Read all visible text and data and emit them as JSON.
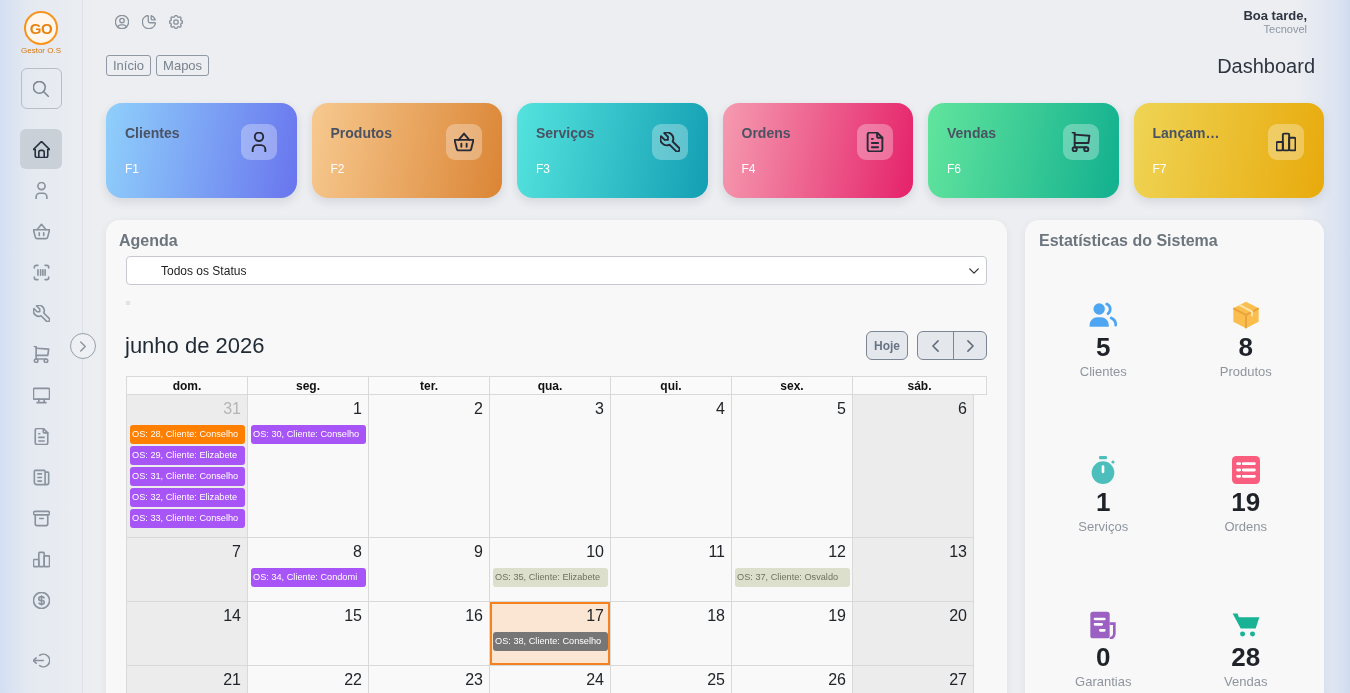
{
  "sidebar": {
    "logo": {
      "mark": "GO",
      "caption": "Gestor O.S"
    },
    "items": [
      {
        "selected": true
      },
      {
        "selected": false
      },
      {
        "selected": false
      },
      {
        "selected": false
      },
      {
        "selected": false
      },
      {
        "selected": false
      },
      {
        "selected": false
      },
      {
        "selected": false
      },
      {
        "selected": false
      },
      {
        "selected": false
      },
      {
        "selected": false
      },
      {
        "selected": false
      }
    ]
  },
  "top_bar": {
    "greeting": "Boa tarde,",
    "user": "Tecnovel"
  },
  "breadcrumbs": [
    "Início",
    "Mapos"
  ],
  "page_title": "Dashboard",
  "shortcuts": [
    {
      "label": "Clientes",
      "key": "F1"
    },
    {
      "label": "Produtos",
      "key": "F2"
    },
    {
      "label": "Serviços",
      "key": "F3"
    },
    {
      "label": "Ordens",
      "key": "F4"
    },
    {
      "label": "Vendas",
      "key": "F6"
    },
    {
      "label": "Lançam…",
      "key": "F7"
    }
  ],
  "agenda": {
    "title": "Agenda",
    "status_filter": {
      "value": "Todos os Status"
    },
    "month_title": "junho de 2026",
    "today_button": "Hoje",
    "weekdays": [
      "dom.",
      "seg.",
      "ter.",
      "qua.",
      "qui.",
      "sex.",
      "sáb."
    ],
    "weeks": [
      {
        "days": [
          {
            "day": "31",
            "outside": true,
            "today": false,
            "events": [
              {
                "text": "OS: 28, Cliente: Conselho",
                "color": "#ff7f00"
              },
              {
                "text": "OS: 29, Cliente: Elizabete",
                "color": "#a855f7"
              },
              {
                "text": "OS: 31, Cliente: Conselho",
                "color": "#a855f7"
              },
              {
                "text": "OS: 32, Cliente: Elizabete",
                "color": "#a855f7"
              },
              {
                "text": "OS: 33, Cliente: Conselho",
                "color": "#a855f7"
              }
            ]
          },
          {
            "day": "1",
            "outside": false,
            "today": false,
            "events": [
              {
                "text": "OS: 30, Cliente: Conselho",
                "color": "#a855f7"
              }
            ]
          },
          {
            "day": "2",
            "outside": false,
            "today": false
          },
          {
            "day": "3",
            "outside": false,
            "today": false
          },
          {
            "day": "4",
            "outside": false,
            "today": false
          },
          {
            "day": "5",
            "outside": false,
            "today": false
          },
          {
            "day": "6",
            "outside": false,
            "today": false
          }
        ]
      },
      {
        "days": [
          {
            "day": "7",
            "outside": false,
            "today": false
          },
          {
            "day": "8",
            "outside": false,
            "today": false,
            "events": [
              {
                "text": "OS: 34, Cliente: Condomi",
                "color": "#a855f7"
              }
            ]
          },
          {
            "day": "9",
            "outside": false,
            "today": false
          },
          {
            "day": "10",
            "outside": false,
            "today": false,
            "events": [
              {
                "text": "OS: 35, Cliente: Elizabete",
                "color": "#dcdfcb"
              }
            ]
          },
          {
            "day": "11",
            "outside": false,
            "today": false
          },
          {
            "day": "12",
            "outside": false,
            "today": false,
            "events": [
              {
                "text": "OS: 37, Cliente: Osvaldo",
                "color": "#dcdfcb"
              }
            ]
          },
          {
            "day": "13",
            "outside": false,
            "today": false
          }
        ]
      },
      {
        "days": [
          {
            "day": "14",
            "outside": false,
            "today": false
          },
          {
            "day": "15",
            "outside": false,
            "today": false
          },
          {
            "day": "16",
            "outside": false,
            "today": false
          },
          {
            "day": "17",
            "outside": false,
            "today": true,
            "events": [
              {
                "text": "OS: 38, Cliente: Conselho",
                "color": "#767676"
              }
            ]
          },
          {
            "day": "18",
            "outside": false,
            "today": false
          },
          {
            "day": "19",
            "outside": false,
            "today": false
          },
          {
            "day": "20",
            "outside": false,
            "today": false
          }
        ]
      },
      {
        "days": [
          {
            "day": "21",
            "outside": false,
            "today": false
          },
          {
            "day": "22",
            "outside": false,
            "today": false
          },
          {
            "day": "23",
            "outside": false,
            "today": false
          },
          {
            "day": "24",
            "outside": false,
            "today": false
          },
          {
            "day": "25",
            "outside": false,
            "today": false
          },
          {
            "day": "26",
            "outside": false,
            "today": false
          },
          {
            "day": "27",
            "outside": false,
            "today": false
          }
        ]
      }
    ]
  },
  "stats": {
    "title": "Estatísticas do Sistema",
    "items": [
      {
        "value": "5",
        "label": "Clientes"
      },
      {
        "value": "8",
        "label": "Produtos"
      },
      {
        "value": "1",
        "label": "Serviços"
      },
      {
        "value": "19",
        "label": "Ordens"
      },
      {
        "value": "0",
        "label": "Garantias"
      },
      {
        "value": "28",
        "label": "Vendas"
      }
    ]
  }
}
